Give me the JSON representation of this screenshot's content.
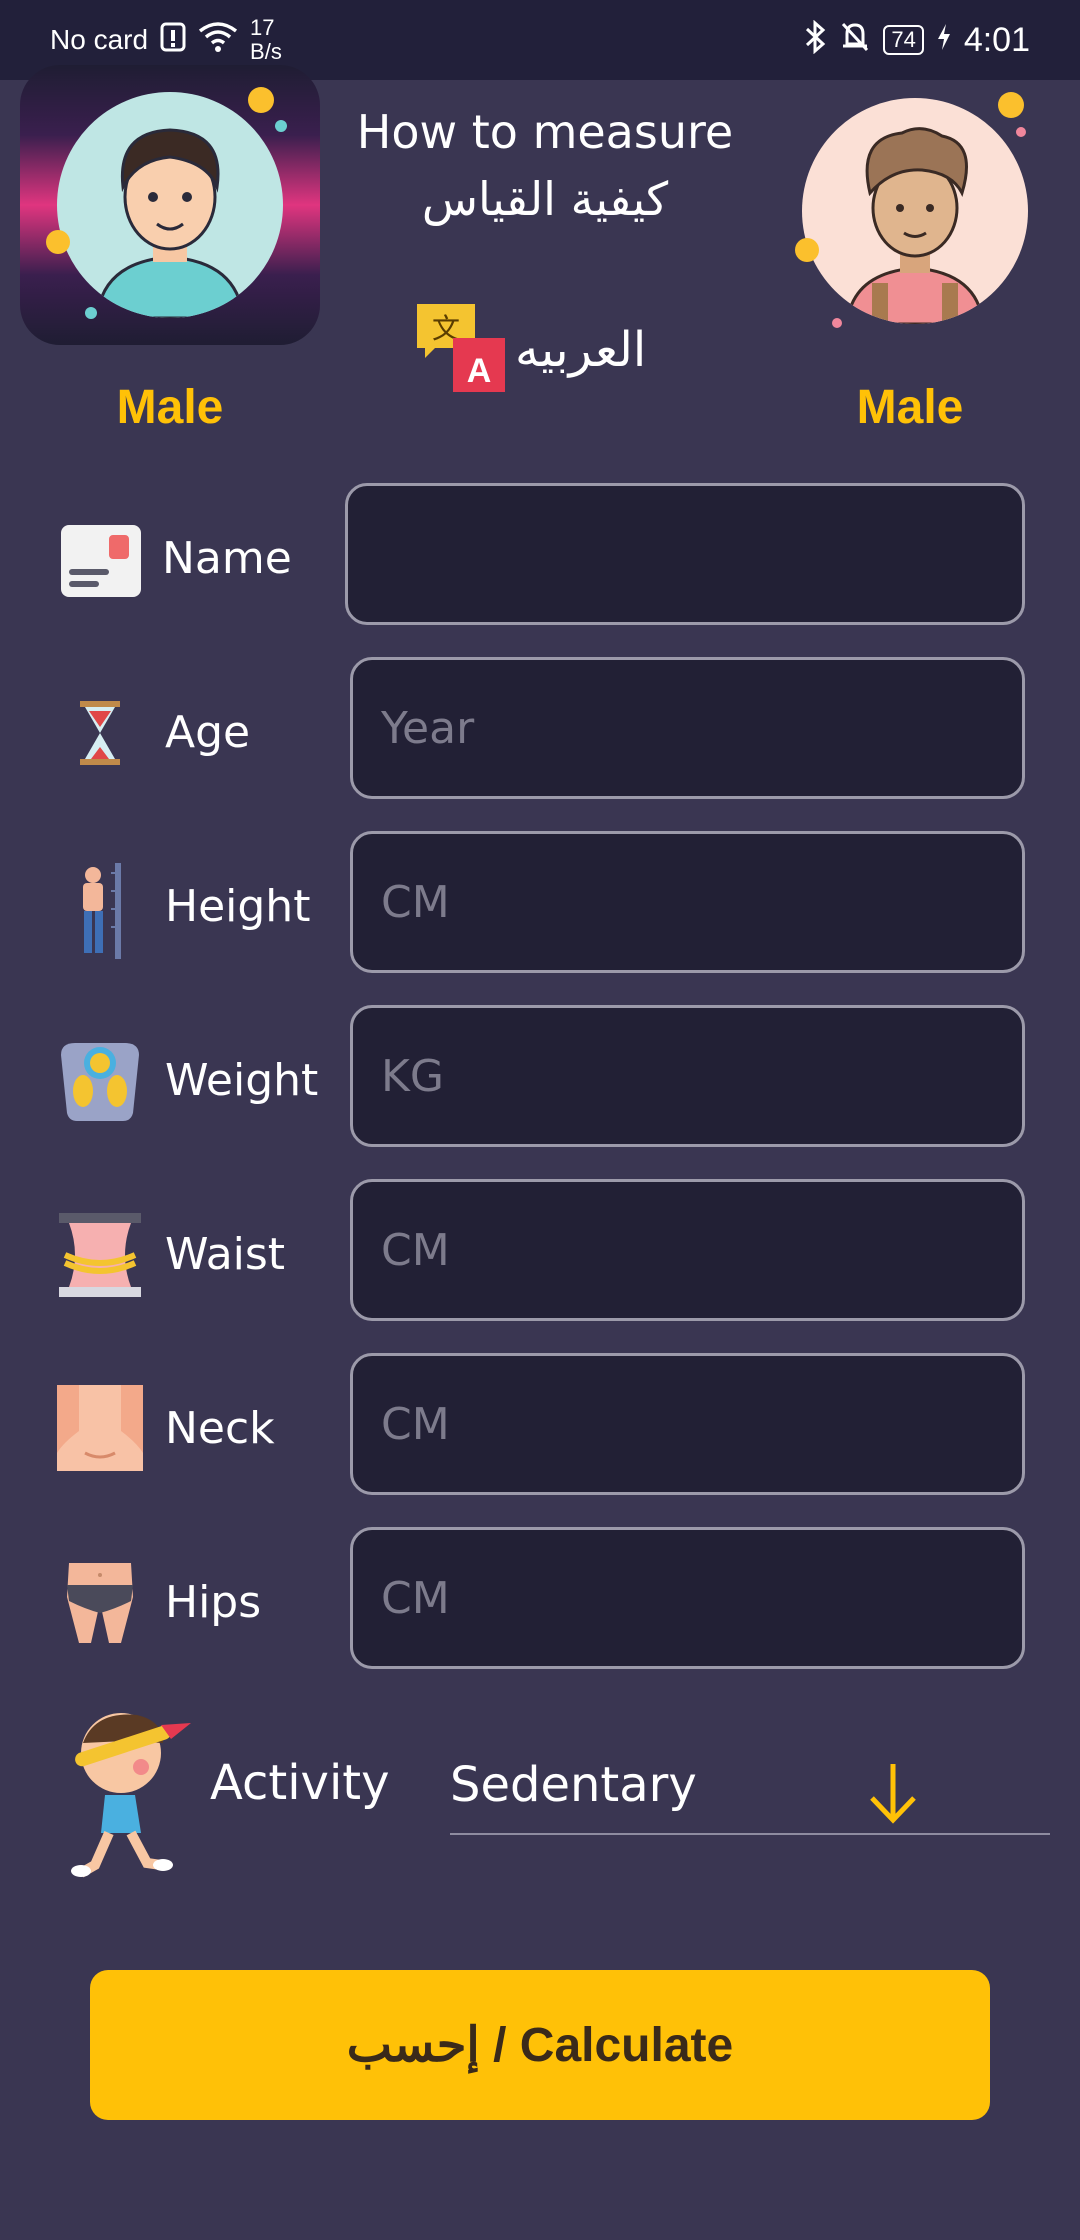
{
  "status_bar": {
    "carrier": "No card",
    "speed_value": "17",
    "speed_unit": "B/s",
    "battery": "74",
    "time": "4:01"
  },
  "header": {
    "title_en": "How to measure",
    "title_ar": "كيفية القياس",
    "language_label": "العربيه",
    "left_gender": "Male",
    "right_gender": "Male"
  },
  "form": {
    "rows": [
      {
        "label": "Name",
        "placeholder": ""
      },
      {
        "label": "Age",
        "placeholder": "Year"
      },
      {
        "label": "Height",
        "placeholder": "CM"
      },
      {
        "label": "Weight",
        "placeholder": "KG"
      },
      {
        "label": "Waist",
        "placeholder": "CM"
      },
      {
        "label": "Neck",
        "placeholder": "CM"
      },
      {
        "label": "Hips",
        "placeholder": "CM"
      }
    ],
    "activity_label": "Activity",
    "activity_value": "Sedentary"
  },
  "calculate_label": "إحسب / Calculate",
  "colors": {
    "background": "#3a3652",
    "accent": "#ffc107",
    "input_bg": "#222035"
  }
}
